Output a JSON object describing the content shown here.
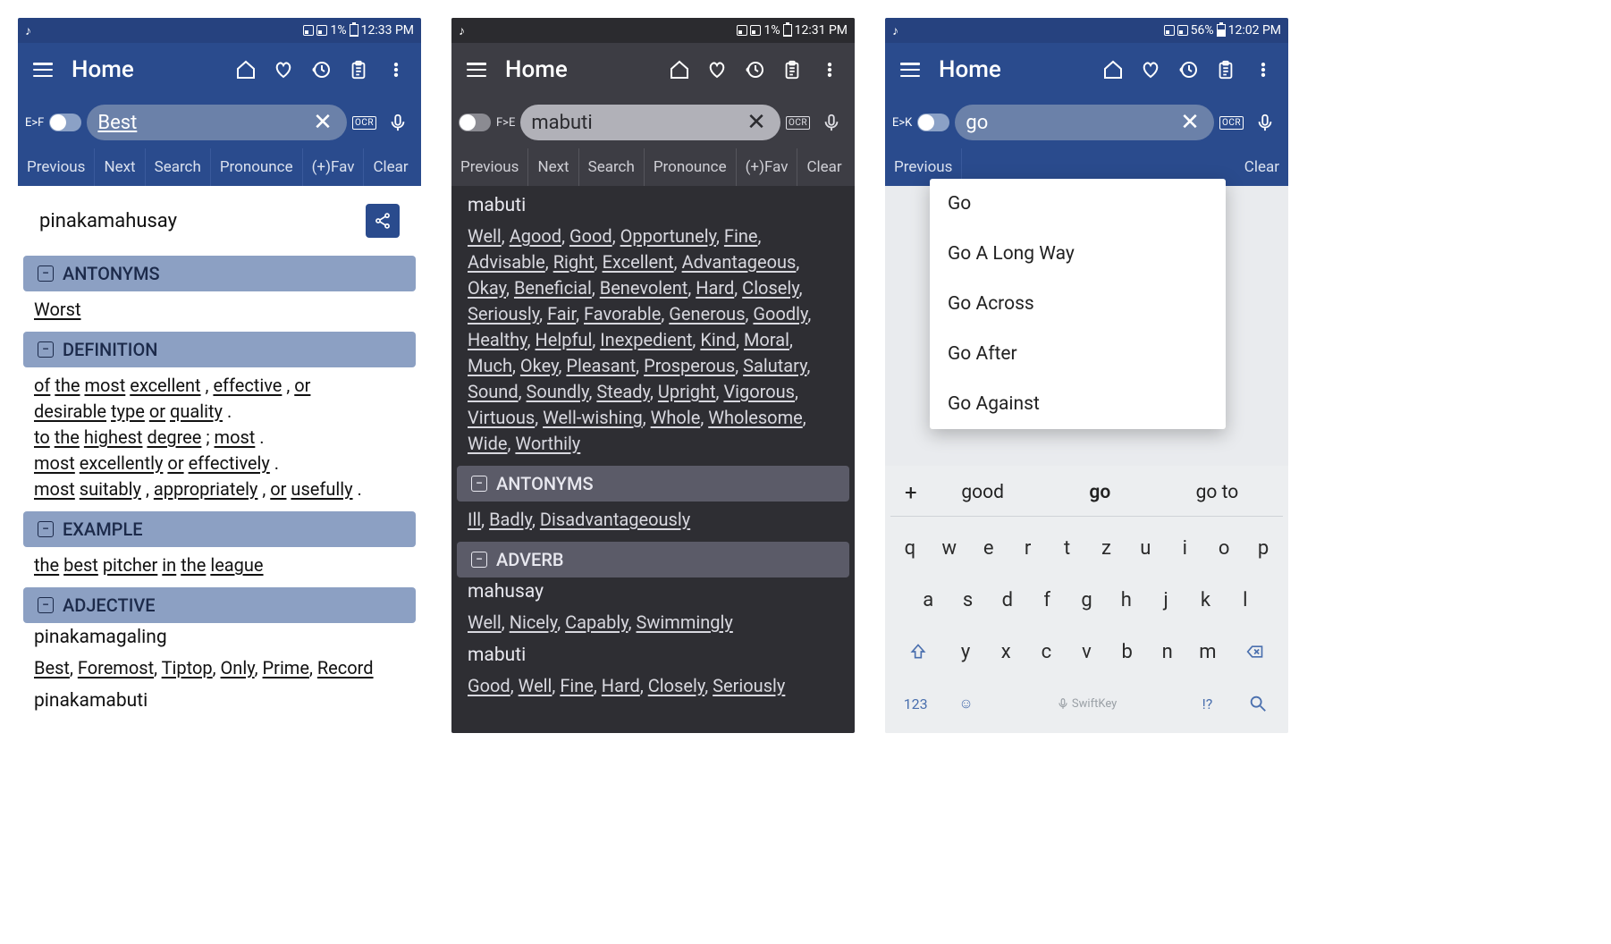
{
  "status": {
    "s1": {
      "battery_pct": "1%",
      "time": "12:33 PM"
    },
    "s2": {
      "battery_pct": "1%",
      "time": "12:31 PM"
    },
    "s3": {
      "battery_pct": "56%",
      "time": "12:02 PM"
    }
  },
  "appbar": {
    "title": "Home"
  },
  "tabs": {
    "previous": "Previous",
    "next": "Next",
    "search": "Search",
    "pronounce": "Pronounce",
    "fav": "(+)Fav",
    "clear": "Clear"
  },
  "screen1": {
    "langpill": "E>F",
    "search_value": "Best",
    "result_title": "pinakamahusay",
    "sections": {
      "antonyms": {
        "label": "ANTONYMS",
        "items": [
          "Worst"
        ]
      },
      "definition": {
        "label": "DEFINITION",
        "lines": [
          [
            "of",
            "the",
            "most",
            "excellent",
            ", ",
            "effective",
            ", ",
            "or"
          ],
          [
            "desirable",
            "type",
            "or",
            "quality",
            "."
          ],
          [
            "to",
            "the",
            "highest",
            "degree",
            "; ",
            "most",
            "."
          ],
          [
            "most",
            "excellently",
            "or",
            "effectively",
            "."
          ],
          [
            "most",
            "suitably",
            ", ",
            "appropriately",
            ", ",
            "or",
            "usefully",
            "."
          ]
        ]
      },
      "example": {
        "label": "EXAMPLE",
        "lines": [
          [
            "the",
            "best",
            "pitcher",
            "in",
            "the",
            "league"
          ]
        ]
      },
      "adjective": {
        "label": "ADJECTIVE",
        "plain1": "pinakamagaling",
        "items1": [
          "Best",
          "Foremost",
          "Tiptop",
          "Only",
          "Prime",
          "Record"
        ],
        "plain2": "pinakamabuti"
      }
    }
  },
  "screen2": {
    "langpill": "F>E",
    "search_value": "mabuti",
    "result_title": "mabuti",
    "synonyms": [
      "Well",
      "Agood",
      "Good",
      "Opportunely",
      "Fine",
      "Advisable",
      "Right",
      "Excellent",
      "Advantageous",
      "Okay",
      "Beneficial",
      "Benevolent",
      "Hard",
      "Closely",
      "Seriously",
      "Fair",
      "Favorable",
      "Generous",
      "Goodly",
      "Healthy",
      "Helpful",
      "Inexpedient",
      "Kind",
      "Moral",
      "Much",
      "Okey",
      "Pleasant",
      "Prosperous",
      "Salutary",
      "Sound",
      "Soundly",
      "Steady",
      "Upright",
      "Vigorous",
      "Virtuous",
      "Well-wishing",
      "Whole",
      "Wholesome",
      "Wide",
      "Worthily"
    ],
    "sections": {
      "antonyms": {
        "label": "ANTONYMS",
        "items": [
          "Ill",
          "Badly",
          "Disadvantageously"
        ]
      },
      "adverb": {
        "label": "ADVERB",
        "plain1": "mahusay",
        "items1": [
          "Well",
          "Nicely",
          "Capably",
          "Swimmingly"
        ],
        "plain2": "mabuti",
        "items2": [
          "Good",
          "Well",
          "Fine",
          "Hard",
          "Closely",
          "Seriously"
        ]
      }
    }
  },
  "screen3": {
    "langpill": "E>K",
    "search_value": "go",
    "suggestions": [
      "Go",
      "Go A Long Way",
      "Go Across",
      "Go After",
      "Go Against"
    ],
    "keyboard": {
      "suggest": {
        "left": "good",
        "mid": "go",
        "right": "go to"
      },
      "row1": [
        "q",
        "w",
        "e",
        "r",
        "t",
        "z",
        "u",
        "i",
        "o",
        "p"
      ],
      "row2": [
        "a",
        "s",
        "d",
        "f",
        "g",
        "h",
        "j",
        "k",
        "l"
      ],
      "row3": [
        "y",
        "x",
        "c",
        "v",
        "b",
        "n",
        "m"
      ],
      "row4": {
        "num": "123",
        "brand": "SwiftKey"
      }
    }
  }
}
